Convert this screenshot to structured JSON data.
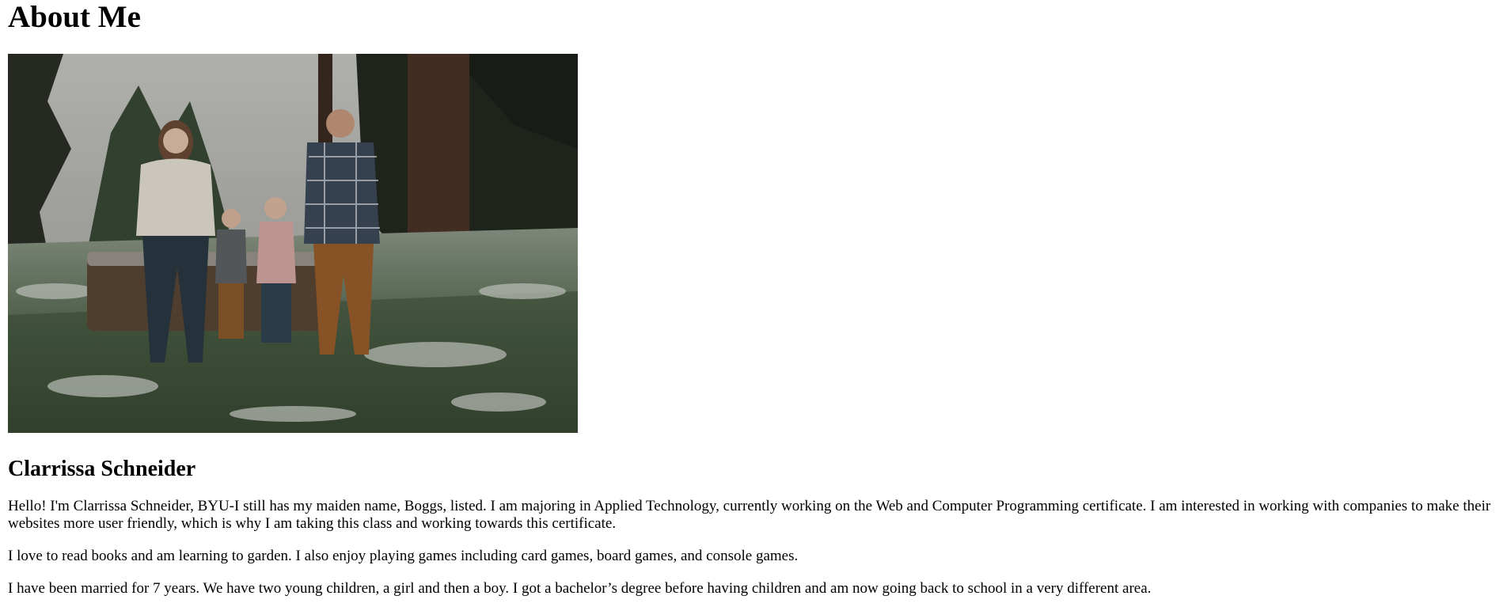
{
  "page": {
    "heading": "About Me",
    "name": "Clarrissa Schneider",
    "paragraphs": [
      "Hello! I'm Clarrissa Schneider, BYU-I still has my maiden name, Boggs, listed. I am majoring in Applied Technology, currently working on the Web and Computer Programming certificate. I am interested in working with companies to make their websites more user friendly, which is why I am taking this class and working towards this certificate.",
      "I love to read books and am learning to garden. I also enjoy playing games including card games, board games, and console games.",
      "I have been married for 7 years. We have two young children, a girl and then a boy. I got a bachelor’s degree before having children and am now going back to school in a very different area."
    ]
  },
  "colors": {
    "text": "#000000",
    "background": "#ffffff"
  }
}
